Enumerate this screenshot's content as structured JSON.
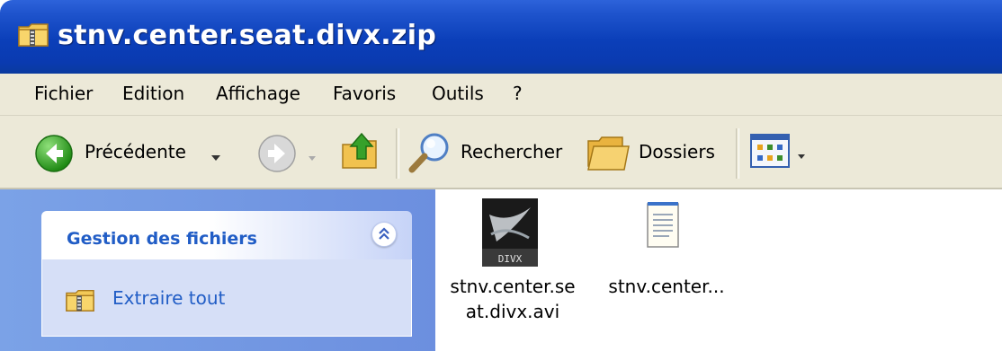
{
  "window": {
    "title": "stnv.center.seat.divx.zip"
  },
  "menu": {
    "items": [
      "Fichier",
      "Edition",
      "Affichage",
      "Favoris",
      "Outils",
      "?"
    ]
  },
  "toolbar": {
    "back_label": "Précédente",
    "search_label": "Rechercher",
    "folders_label": "Dossiers"
  },
  "taskpane": {
    "group_title": "Gestion des fichiers",
    "task_label": "Extraire tout"
  },
  "files": [
    {
      "name": "stnv.center.se\nat.divx.avi",
      "icon": "divx-video-icon"
    },
    {
      "name": "stnv.center...",
      "icon": "notepad-icon"
    }
  ],
  "colors": {
    "titlebar": "#0a3ab0",
    "link": "#215dc6",
    "taskpane": "#7ba2e7",
    "chrome": "#ece9d8"
  }
}
